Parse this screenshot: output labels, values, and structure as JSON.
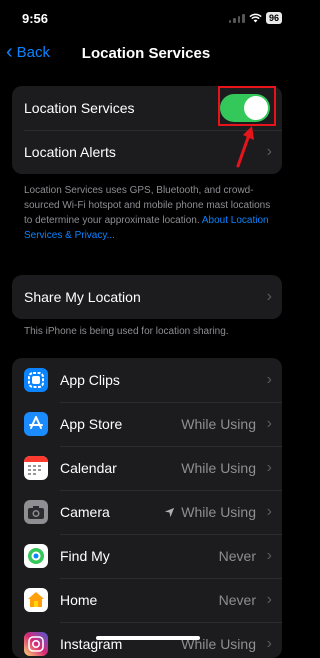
{
  "status": {
    "time": "9:56",
    "battery": "96"
  },
  "nav": {
    "back_label": "Back",
    "title": "Location Services"
  },
  "group1": [
    {
      "label": "Location Services",
      "toggle_on": true
    },
    {
      "label": "Location Alerts"
    }
  ],
  "note1": {
    "text": "Location Services uses GPS, Bluetooth, and crowd-sourced Wi-Fi hotspot and mobile phone mast locations to determine your approximate location. ",
    "link": "About Location Services & Privacy..."
  },
  "share": {
    "label": "Share My Location"
  },
  "note2": "This iPhone is being used for location sharing.",
  "apps": [
    {
      "name": "App Clips",
      "value": "",
      "icon": "app-clips-icon"
    },
    {
      "name": "App Store",
      "value": "While Using",
      "icon": "app-store-icon"
    },
    {
      "name": "Calendar",
      "value": "While Using",
      "icon": "calendar-icon"
    },
    {
      "name": "Camera",
      "value": "While Using",
      "icon": "camera-icon",
      "location_arrow": true
    },
    {
      "name": "Find My",
      "value": "Never",
      "icon": "find-my-icon"
    },
    {
      "name": "Home",
      "value": "Never",
      "icon": "home-icon"
    },
    {
      "name": "Instagram",
      "value": "While Using",
      "icon": "instagram-icon"
    }
  ],
  "colors": {
    "accent": "#0a84ff",
    "toggle_on": "#34c759",
    "annotation": "#e8141b"
  }
}
